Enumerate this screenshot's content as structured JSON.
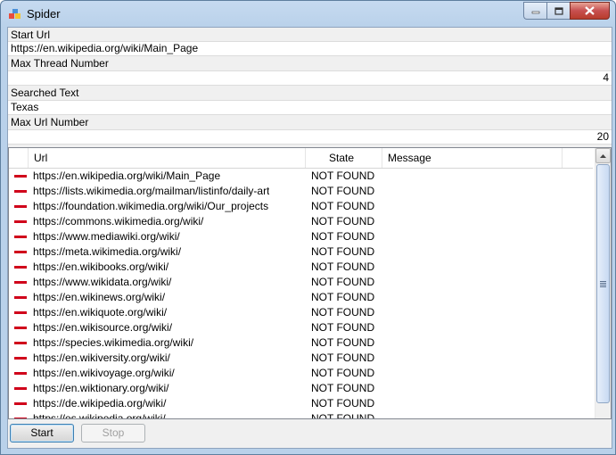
{
  "window": {
    "title": "Spider"
  },
  "form": {
    "start_url_label": "Start Url",
    "start_url_value": "https://en.wikipedia.org/wiki/Main_Page",
    "max_thread_label": "Max Thread Number",
    "max_thread_value": "4",
    "searched_text_label": "Searched Text",
    "searched_text_value": "Texas",
    "max_url_label": "Max Url Number",
    "max_url_value": "20"
  },
  "list": {
    "columns": {
      "url": "Url",
      "state": "State",
      "message": "Message"
    },
    "row_icon_color": "#d0021b",
    "rows": [
      {
        "url": "https://en.wikipedia.org/wiki/Main_Page",
        "state": "NOT FOUND",
        "message": ""
      },
      {
        "url": "https://lists.wikimedia.org/mailman/listinfo/daily-article-l",
        "state": "NOT FOUND",
        "message": ""
      },
      {
        "url": "https://foundation.wikimedia.org/wiki/Our_projects",
        "state": "NOT FOUND",
        "message": ""
      },
      {
        "url": "https://commons.wikimedia.org/wiki/",
        "state": "NOT FOUND",
        "message": ""
      },
      {
        "url": "https://www.mediawiki.org/wiki/",
        "state": "NOT FOUND",
        "message": ""
      },
      {
        "url": "https://meta.wikimedia.org/wiki/",
        "state": "NOT FOUND",
        "message": ""
      },
      {
        "url": "https://en.wikibooks.org/wiki/",
        "state": "NOT FOUND",
        "message": ""
      },
      {
        "url": "https://www.wikidata.org/wiki/",
        "state": "NOT FOUND",
        "message": ""
      },
      {
        "url": "https://en.wikinews.org/wiki/",
        "state": "NOT FOUND",
        "message": ""
      },
      {
        "url": "https://en.wikiquote.org/wiki/",
        "state": "NOT FOUND",
        "message": ""
      },
      {
        "url": "https://en.wikisource.org/wiki/",
        "state": "NOT FOUND",
        "message": ""
      },
      {
        "url": "https://species.wikimedia.org/wiki/",
        "state": "NOT FOUND",
        "message": ""
      },
      {
        "url": "https://en.wikiversity.org/wiki/",
        "state": "NOT FOUND",
        "message": ""
      },
      {
        "url": "https://en.wikivoyage.org/wiki/",
        "state": "NOT FOUND",
        "message": ""
      },
      {
        "url": "https://en.wiktionary.org/wiki/",
        "state": "NOT FOUND",
        "message": ""
      },
      {
        "url": "https://de.wikipedia.org/wiki/",
        "state": "NOT FOUND",
        "message": ""
      },
      {
        "url": "https://es.wikipedia.org/wiki/",
        "state": "NOT FOUND",
        "message": ""
      }
    ]
  },
  "buttons": {
    "start": "Start",
    "stop": "Stop"
  }
}
